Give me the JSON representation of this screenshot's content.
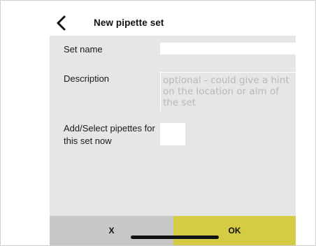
{
  "header": {
    "title": "New pipette set",
    "back_icon": "chevron-left-icon"
  },
  "form": {
    "set_name_label": "Set name",
    "set_name_value": "",
    "description_label": "Description",
    "description_placeholder": "optional - could give a hint on the location or aim of the set",
    "description_value": "",
    "add_pipettes_label": "Add/Select pipettes for this set now",
    "add_pipettes_checked": false
  },
  "footer": {
    "cancel_label": "X",
    "ok_label": "OK"
  },
  "colors": {
    "panel_bg": "#e6e6e6",
    "cancel_bg": "#c7c7c7",
    "ok_bg": "#d6cb45"
  }
}
